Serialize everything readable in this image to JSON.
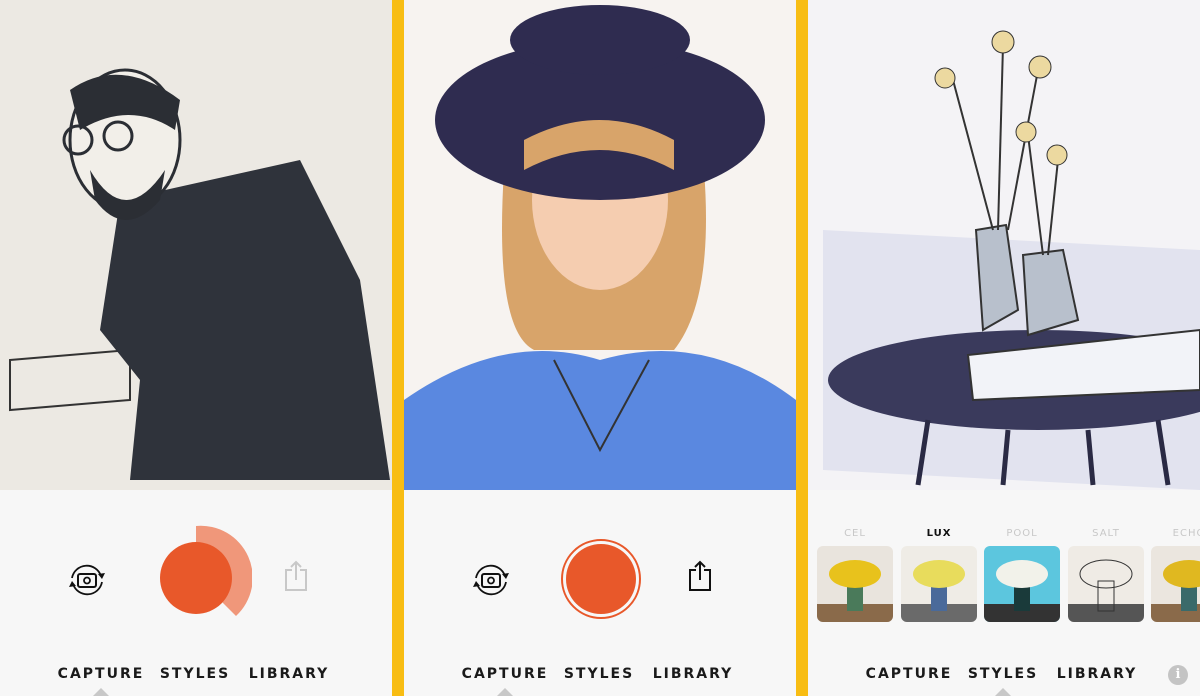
{
  "colors": {
    "accent": "#e8582a",
    "accent_light": "#f0977a",
    "divider": "#f8bd13"
  },
  "nav": {
    "capture": "CAPTURE",
    "styles": "STYLES",
    "library": "LIBRARY"
  },
  "panels": [
    {
      "active_tab": "capture",
      "capture_progress": 0.4,
      "share_enabled": false
    },
    {
      "active_tab": "capture",
      "share_enabled": true
    },
    {
      "active_tab": "styles",
      "styles": [
        {
          "label": "CEL",
          "active": false,
          "bg": "#e9e4dd"
        },
        {
          "label": "LUX",
          "active": true,
          "bg": "#efece6"
        },
        {
          "label": "POOL",
          "active": false,
          "bg": "#5cc6de"
        },
        {
          "label": "SALT",
          "active": false,
          "bg": "#efebe5"
        },
        {
          "label": "ECHO",
          "active": false,
          "bg": "#ebe6df"
        }
      ],
      "info_label": "i"
    }
  ]
}
